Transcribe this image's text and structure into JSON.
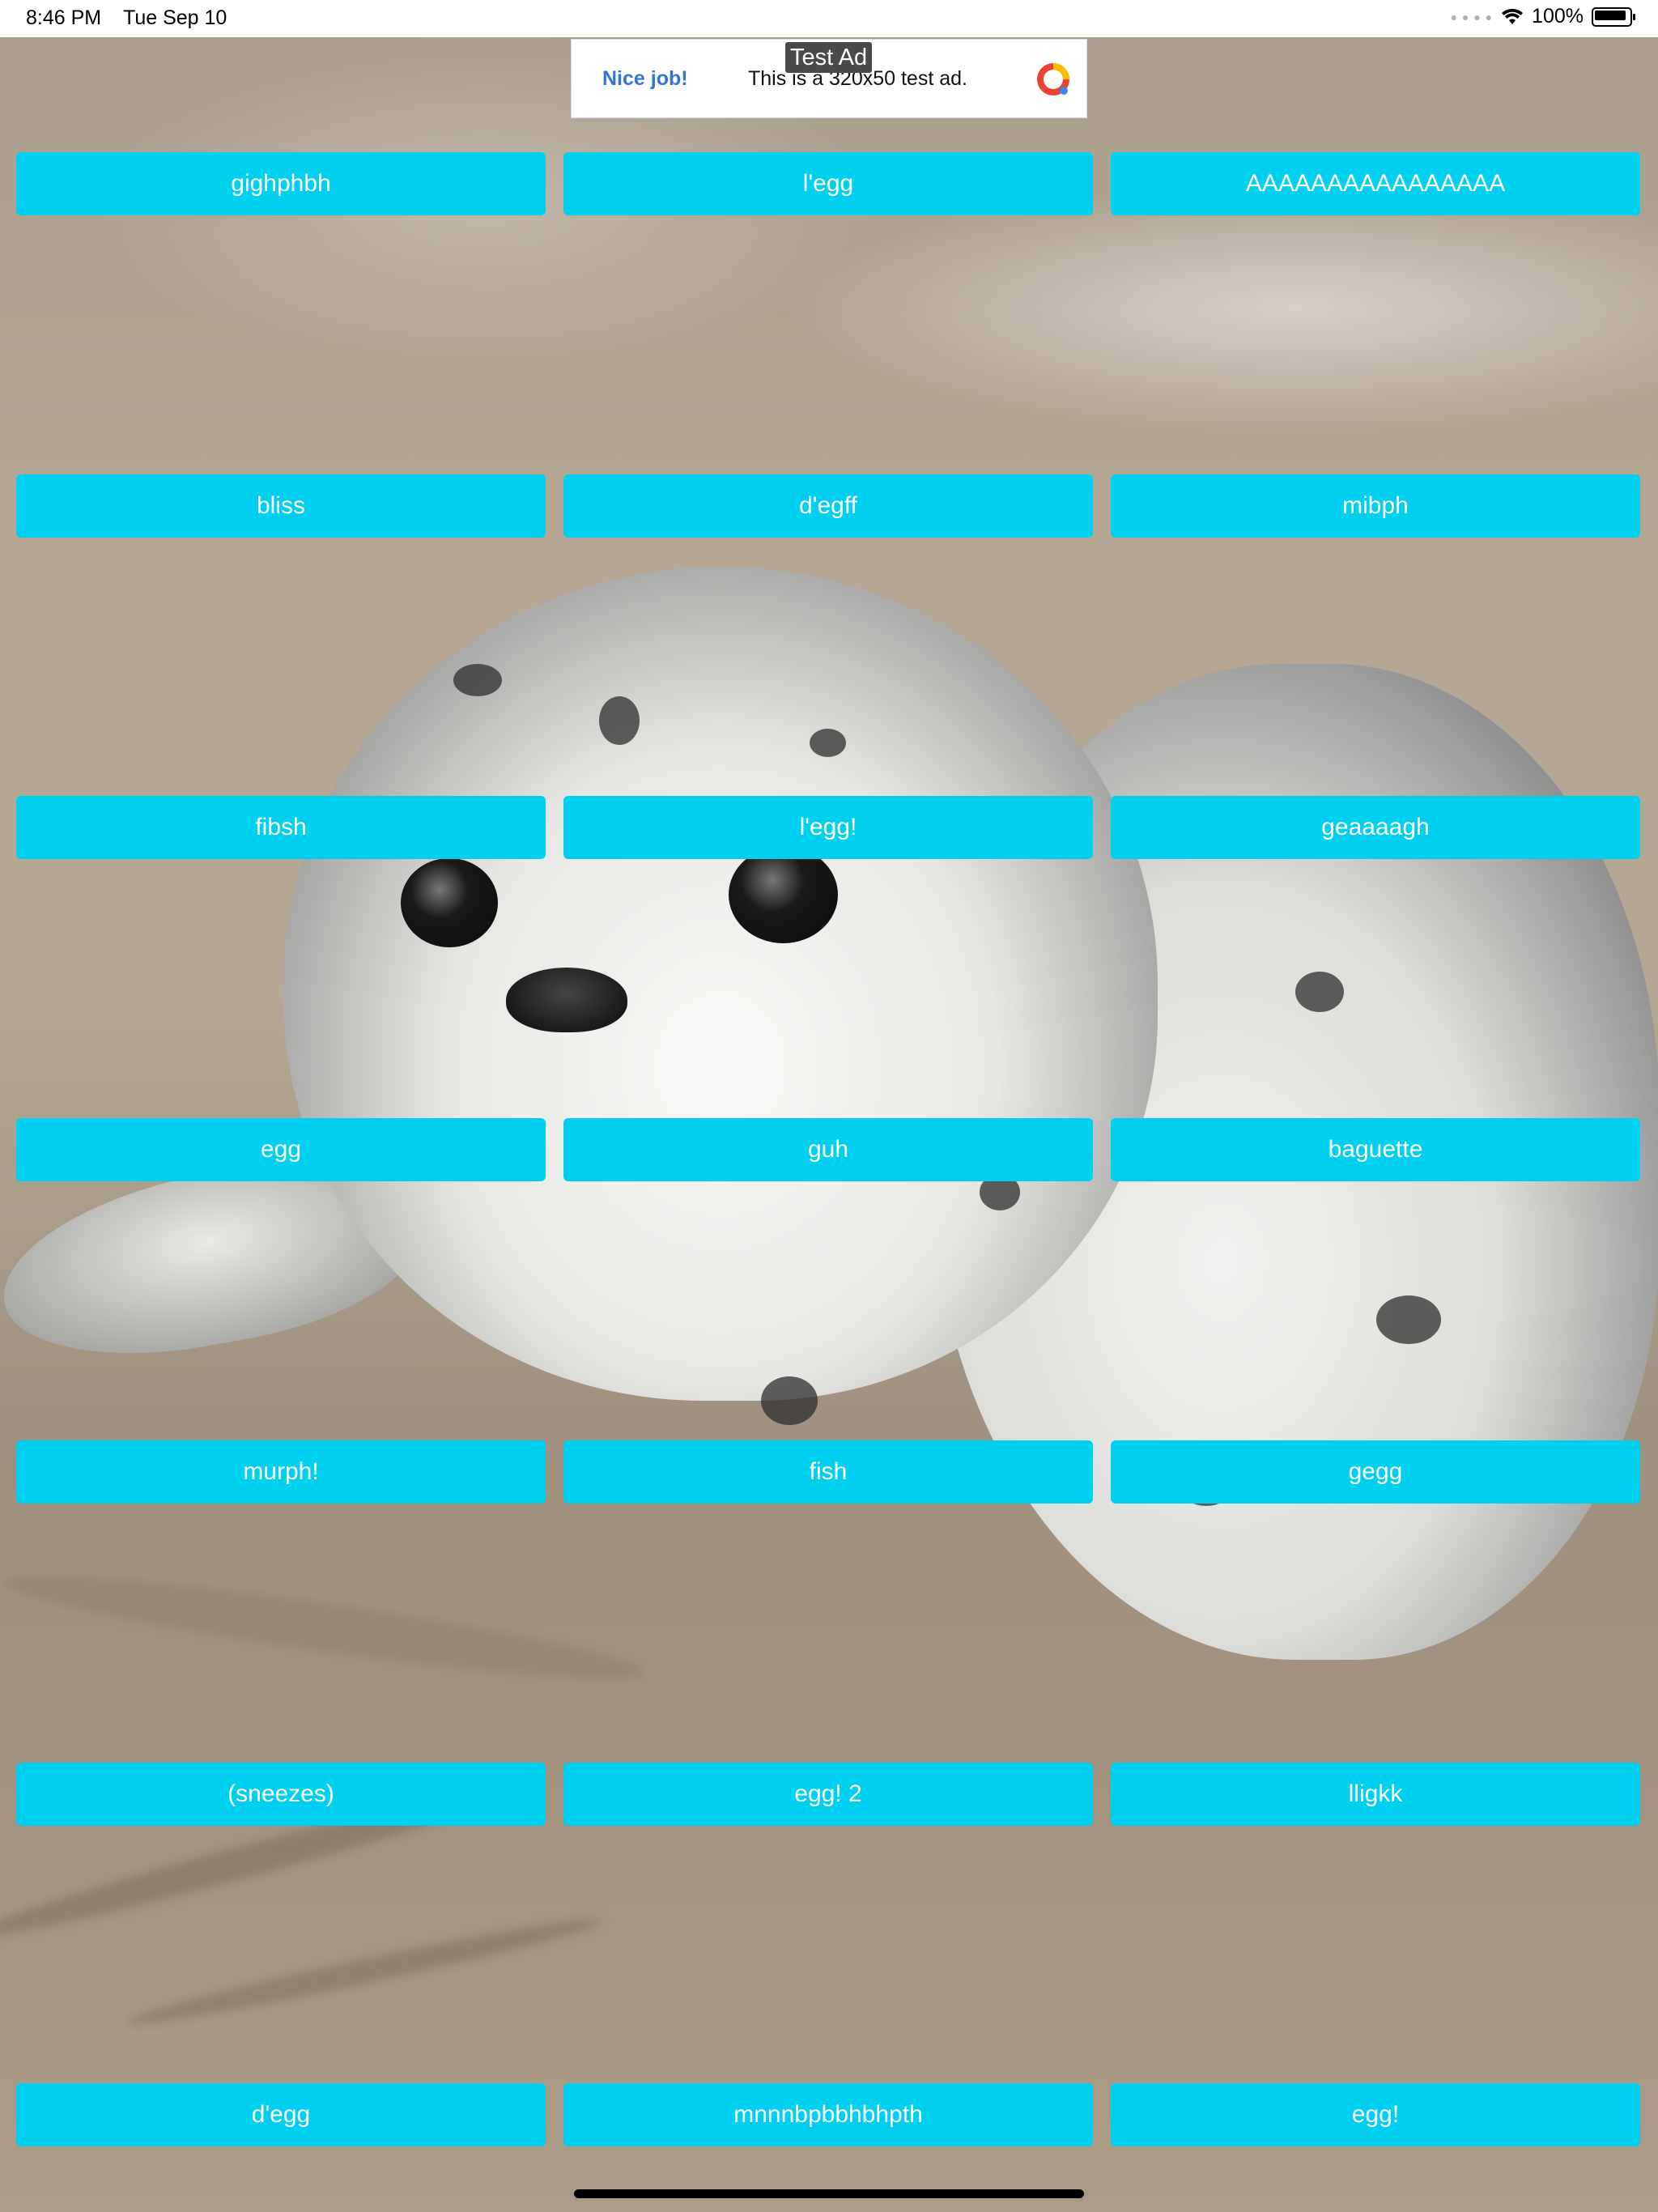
{
  "status_bar": {
    "time": "8:46 PM",
    "date": "Tue Sep 10",
    "battery": "100%",
    "signal_icon": "dots-icon",
    "wifi_icon": "wifi-icon"
  },
  "ad": {
    "tag": "Test Ad",
    "headline": "Nice job!",
    "body": "This is a 320x50 test ad.",
    "logo_icon": "ads-logo-icon"
  },
  "buttons": [
    [
      "gighphbh",
      "l'egg",
      "AAAAAAAAAAAAAAAA"
    ],
    [
      "bliss",
      "d'egff",
      "mibph"
    ],
    [
      "fibsh",
      "l'egg!",
      "geaaaagh"
    ],
    [
      "egg",
      "guh",
      "baguette"
    ],
    [
      "murph!",
      "fish",
      "gegg"
    ],
    [
      "(sneezes)",
      "egg! 2",
      "lligkk"
    ],
    [
      "d'egg",
      "mnnnbpbbhbhpth",
      "egg!"
    ]
  ],
  "colors": {
    "button_bg": "#00d0f0",
    "button_text": "#ffffff",
    "ad_link": "#3178d6"
  }
}
